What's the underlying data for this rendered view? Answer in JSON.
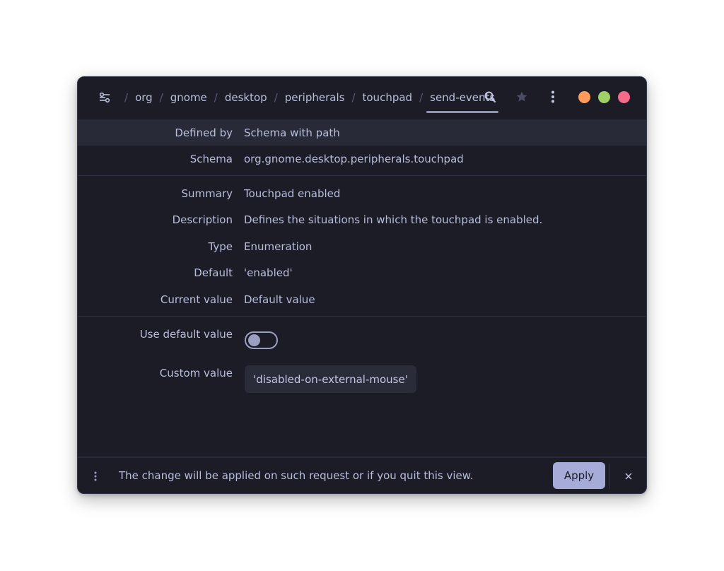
{
  "header": {
    "breadcrumb": [
      "org",
      "gnome",
      "desktop",
      "peripherals",
      "touchpad",
      "send-events"
    ],
    "active_crumb": "send-events",
    "icons": {
      "root": "settings-sliders-icon",
      "search": "search-icon",
      "bookmark": "star-icon",
      "menu": "vertical-dots-icon"
    },
    "window_controls": {
      "minimize_color": "#fd9a5c",
      "maximize_color": "#9fd067",
      "close_color": "#f56c8a"
    }
  },
  "info": {
    "defined_by": {
      "label": "Defined by",
      "value": "Schema with path"
    },
    "schema": {
      "label": "Schema",
      "value": "org.gnome.desktop.peripherals.touchpad"
    },
    "summary": {
      "label": "Summary",
      "value": "Touchpad enabled"
    },
    "description": {
      "label": "Description",
      "value": "Defines the situations in which the touchpad is enabled."
    },
    "type": {
      "label": "Type",
      "value": "Enumeration"
    },
    "default": {
      "label": "Default",
      "value": "'enabled'"
    },
    "current_value": {
      "label": "Current value",
      "value": "Default value"
    }
  },
  "edit": {
    "use_default": {
      "label": "Use default value",
      "checked": false
    },
    "custom_value": {
      "label": "Custom value",
      "value": "'disabled-on-external-mouse'"
    }
  },
  "bottom_bar": {
    "message": "The change will be applied on such request or if you quit this view.",
    "apply_label": "Apply",
    "close_symbol": "×"
  },
  "colors": {
    "background": "#1c1c27",
    "accent": "#a6abd8",
    "text": "#b9bedb"
  }
}
